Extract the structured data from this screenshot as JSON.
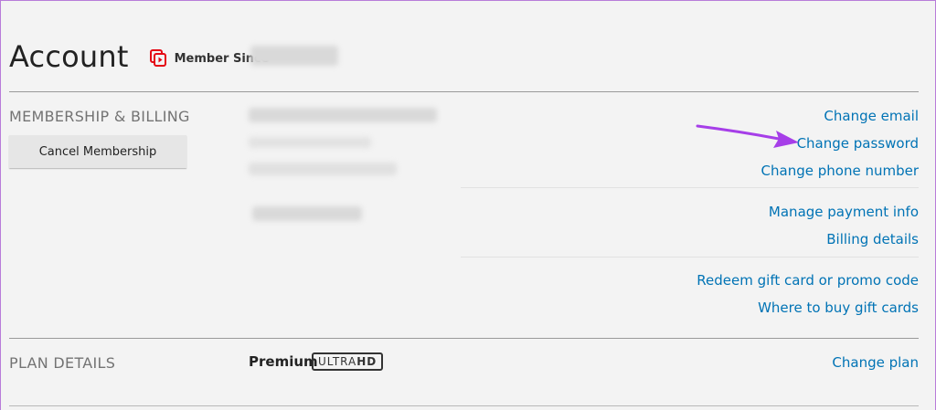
{
  "header": {
    "title": "Account",
    "member_since_label": "Member Since"
  },
  "membership": {
    "section_title": "MEMBERSHIP & BILLING",
    "cancel_button_label": "Cancel Membership",
    "links": [
      "Change email",
      "Change password",
      "Change phone number",
      "Manage payment info",
      "Billing details",
      "Redeem gift card or promo code",
      "Where to buy gift cards"
    ]
  },
  "plan": {
    "section_title": "PLAN DETAILS",
    "plan_name": "Premium",
    "badge_light": "ULTRA",
    "badge_bold": "HD",
    "change_plan_label": "Change plan"
  },
  "colors": {
    "link": "#0073b5",
    "brand_red": "#e50914",
    "annotation_arrow": "#a63ee8"
  }
}
